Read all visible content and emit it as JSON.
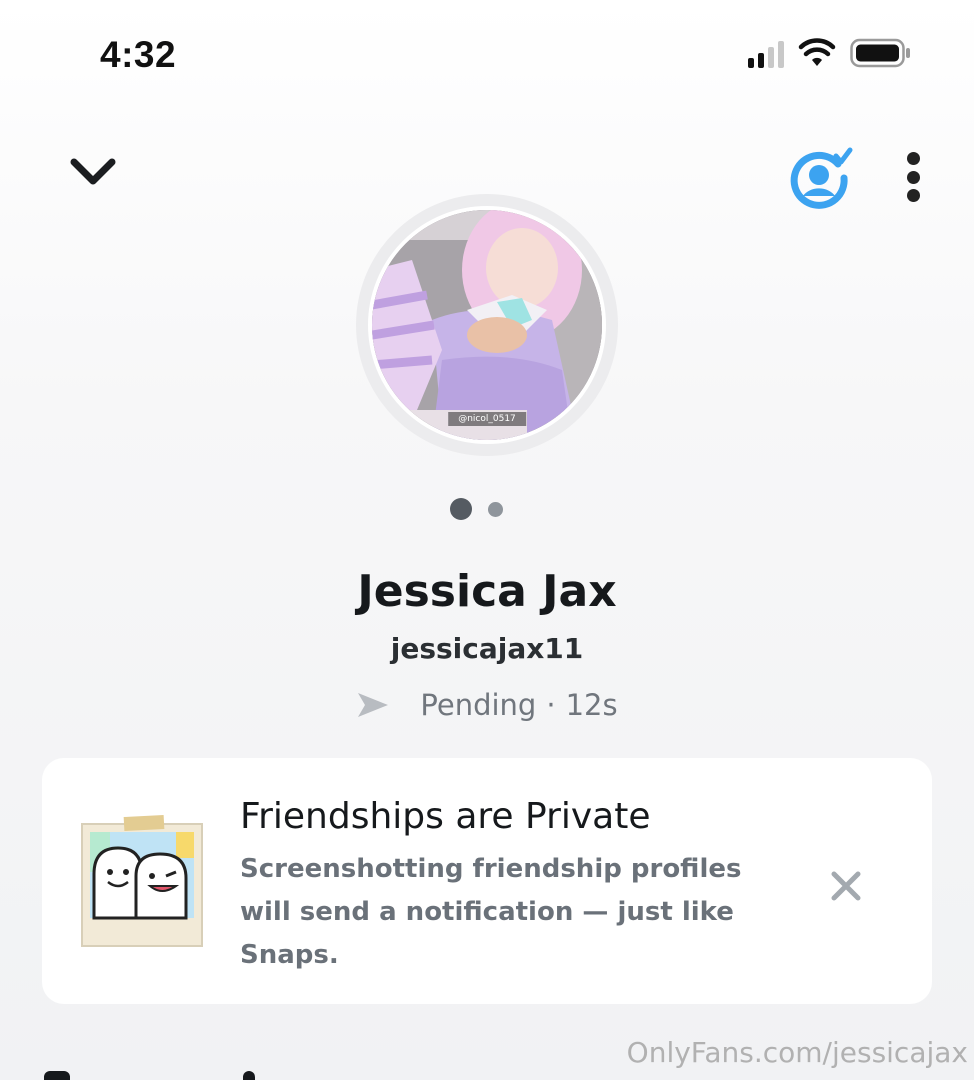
{
  "status_bar": {
    "time": "4:32",
    "icons": [
      "cellular-signal-icon",
      "wifi-icon",
      "battery-icon"
    ]
  },
  "top_bar": {
    "back_icon": "chevron-down-icon",
    "friend_badge_icon": "friend-check-icon",
    "more_icon": "more-vertical-icon",
    "accent_color": "#3ca3f0"
  },
  "profile": {
    "avatar_caption": "@nicol_0517",
    "display_name": "Jessica Jax",
    "username": "jessicajax11",
    "status_icon": "sent-arrow-icon",
    "status": "Pending",
    "separator": "·",
    "elapsed": "12s",
    "carousel": {
      "pages": 2,
      "active": 1
    }
  },
  "privacy_card": {
    "illustration": "ghosts-polaroid-illustration",
    "title": "Friendships are Private",
    "body": "Screenshotting friendship profiles will send a notification — just like Snaps.",
    "close_icon": "close-icon"
  },
  "watermark": "OnlyFans.com/jessicajax"
}
